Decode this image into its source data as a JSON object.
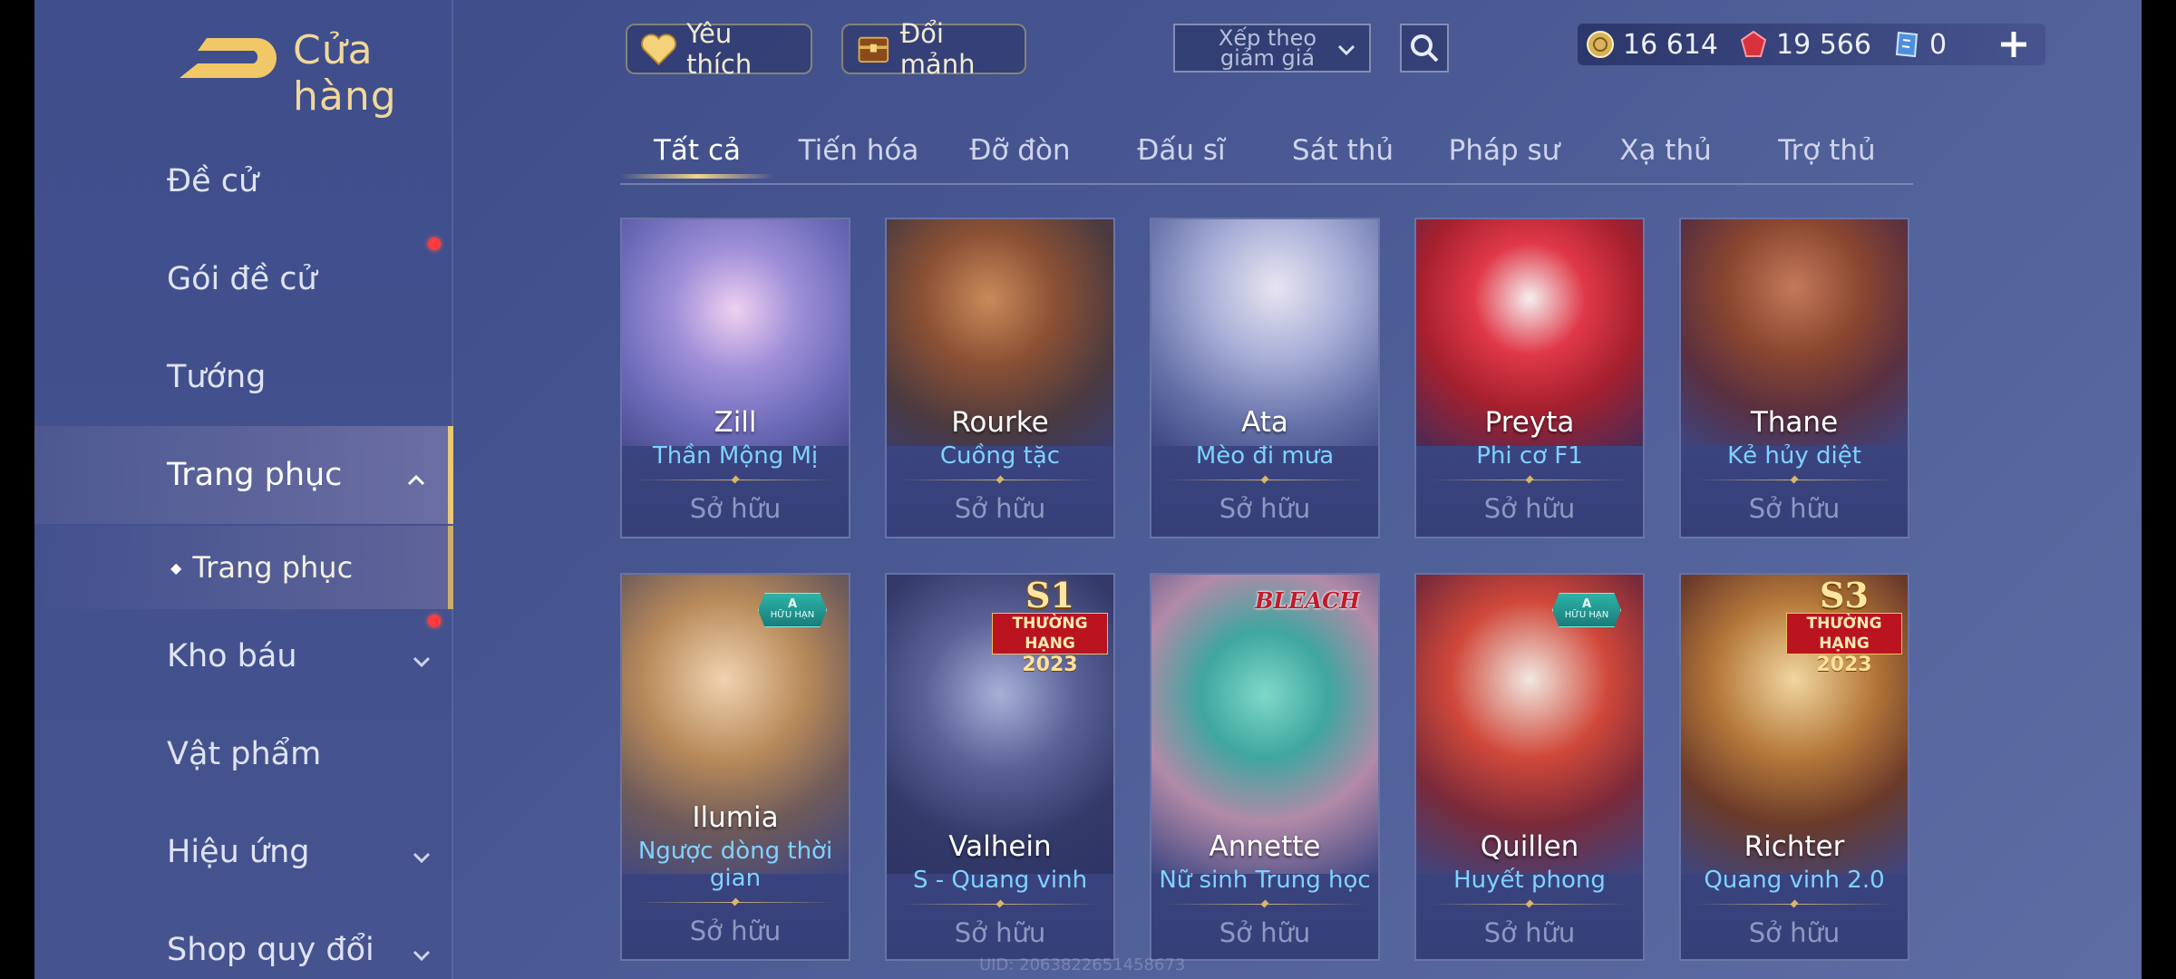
{
  "header": {
    "title": "Cửa hàng",
    "favorites_label": "Yêu thích",
    "exchange_label": "Đổi mảnh",
    "sort_label": "Xếp theo giảm giá"
  },
  "currency": {
    "gold": "16 614",
    "gems": "19 566",
    "vouchers": "0"
  },
  "sidebar": {
    "items": [
      {
        "label": "Đề cử"
      },
      {
        "label": "Gói đề cử"
      },
      {
        "label": "Tướng"
      },
      {
        "label": "Trang phục"
      },
      {
        "label": "Trang phục"
      },
      {
        "label": "Kho báu"
      },
      {
        "label": "Vật phẩm"
      },
      {
        "label": "Hiệu ứng"
      },
      {
        "label": "Shop quy đổi"
      }
    ]
  },
  "tabs": [
    "Tất cả",
    "Tiến hóa",
    "Đỡ đòn",
    "Đấu sĩ",
    "Sát thủ",
    "Pháp sư",
    "Xạ thủ",
    "Trợ thủ"
  ],
  "cards": [
    {
      "hero": "Zill",
      "skin": "Thần Mộng Mị",
      "status": "Sở hữu"
    },
    {
      "hero": "Rourke",
      "skin": "Cuồng tặc",
      "status": "Sở hữu"
    },
    {
      "hero": "Ata",
      "skin": "Mèo đi mưa",
      "status": "Sở hữu"
    },
    {
      "hero": "Preyta",
      "skin": "Phi cơ F1",
      "status": "Sở hữu"
    },
    {
      "hero": "Thane",
      "skin": "Kẻ hủy diệt",
      "status": "Sở hữu"
    },
    {
      "hero": "Ilumia",
      "skin": "Ngược dòng thời gian",
      "status": "Sở hữu"
    },
    {
      "hero": "Valhein",
      "skin": "S - Quang vinh",
      "status": "Sở hữu"
    },
    {
      "hero": "Annette",
      "skin": "Nữ sinh Trung học",
      "status": "Sở hữu"
    },
    {
      "hero": "Quillen",
      "skin": "Huyết phong",
      "status": "Sở hữu"
    },
    {
      "hero": "Richter",
      "skin": "Quang vinh 2.0",
      "status": "Sở hữu"
    }
  ],
  "badges": {
    "limited_grade": "A",
    "limited_text": "HỮU HẠN",
    "valhein_season": "S1",
    "richter_season": "S3",
    "rank_text": "THƯỜNG HẠNG",
    "rank_year": "2023",
    "collab": "BLEACH"
  },
  "uid": "UID: 2063822651458673",
  "colors": {
    "accent_gold": "#e9c978",
    "skin_name": "#7fd2ff",
    "notification": "#ff3b3b"
  }
}
